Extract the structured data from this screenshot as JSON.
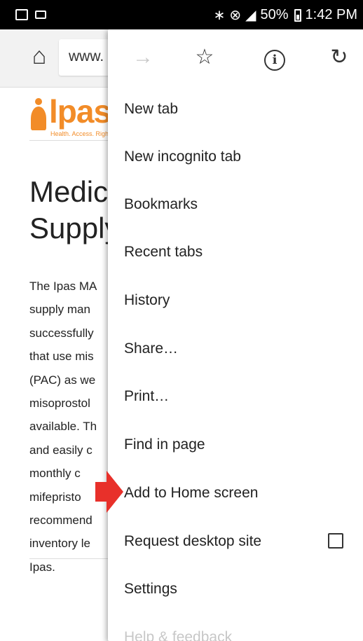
{
  "status_bar": {
    "battery": "50%",
    "time": "1:42 PM",
    "icons": [
      "bluetooth-icon",
      "mute-icon",
      "signal-icon",
      "battery-icon"
    ]
  },
  "toolbar": {
    "url": "www."
  },
  "page": {
    "logo_text": "lpas",
    "logo_tagline": "Health. Access. Rights.",
    "title_lines": [
      "Medica",
      "Supply"
    ],
    "paragraph_lines": [
      "The Ipas MA",
      "supply man",
      "successfully",
      "that use mis",
      "(PAC) as we",
      "misoprostol",
      "available. Th",
      "and easily c",
      "monthly c",
      "mifepristo",
      "recommend",
      "inventory le",
      "Ipas."
    ]
  },
  "menu": {
    "items": [
      {
        "label": "New tab"
      },
      {
        "label": "New incognito tab"
      },
      {
        "label": "Bookmarks"
      },
      {
        "label": "Recent tabs"
      },
      {
        "label": "History"
      },
      {
        "label": "Share…"
      },
      {
        "label": "Print…"
      },
      {
        "label": "Find in page"
      },
      {
        "label": "Add to Home screen"
      },
      {
        "label": "Request desktop site"
      },
      {
        "label": "Settings"
      },
      {
        "label": "Help & feedback"
      }
    ]
  },
  "colors": {
    "brand_orange": "#f28c28",
    "annotation_red": "#e8302a"
  }
}
